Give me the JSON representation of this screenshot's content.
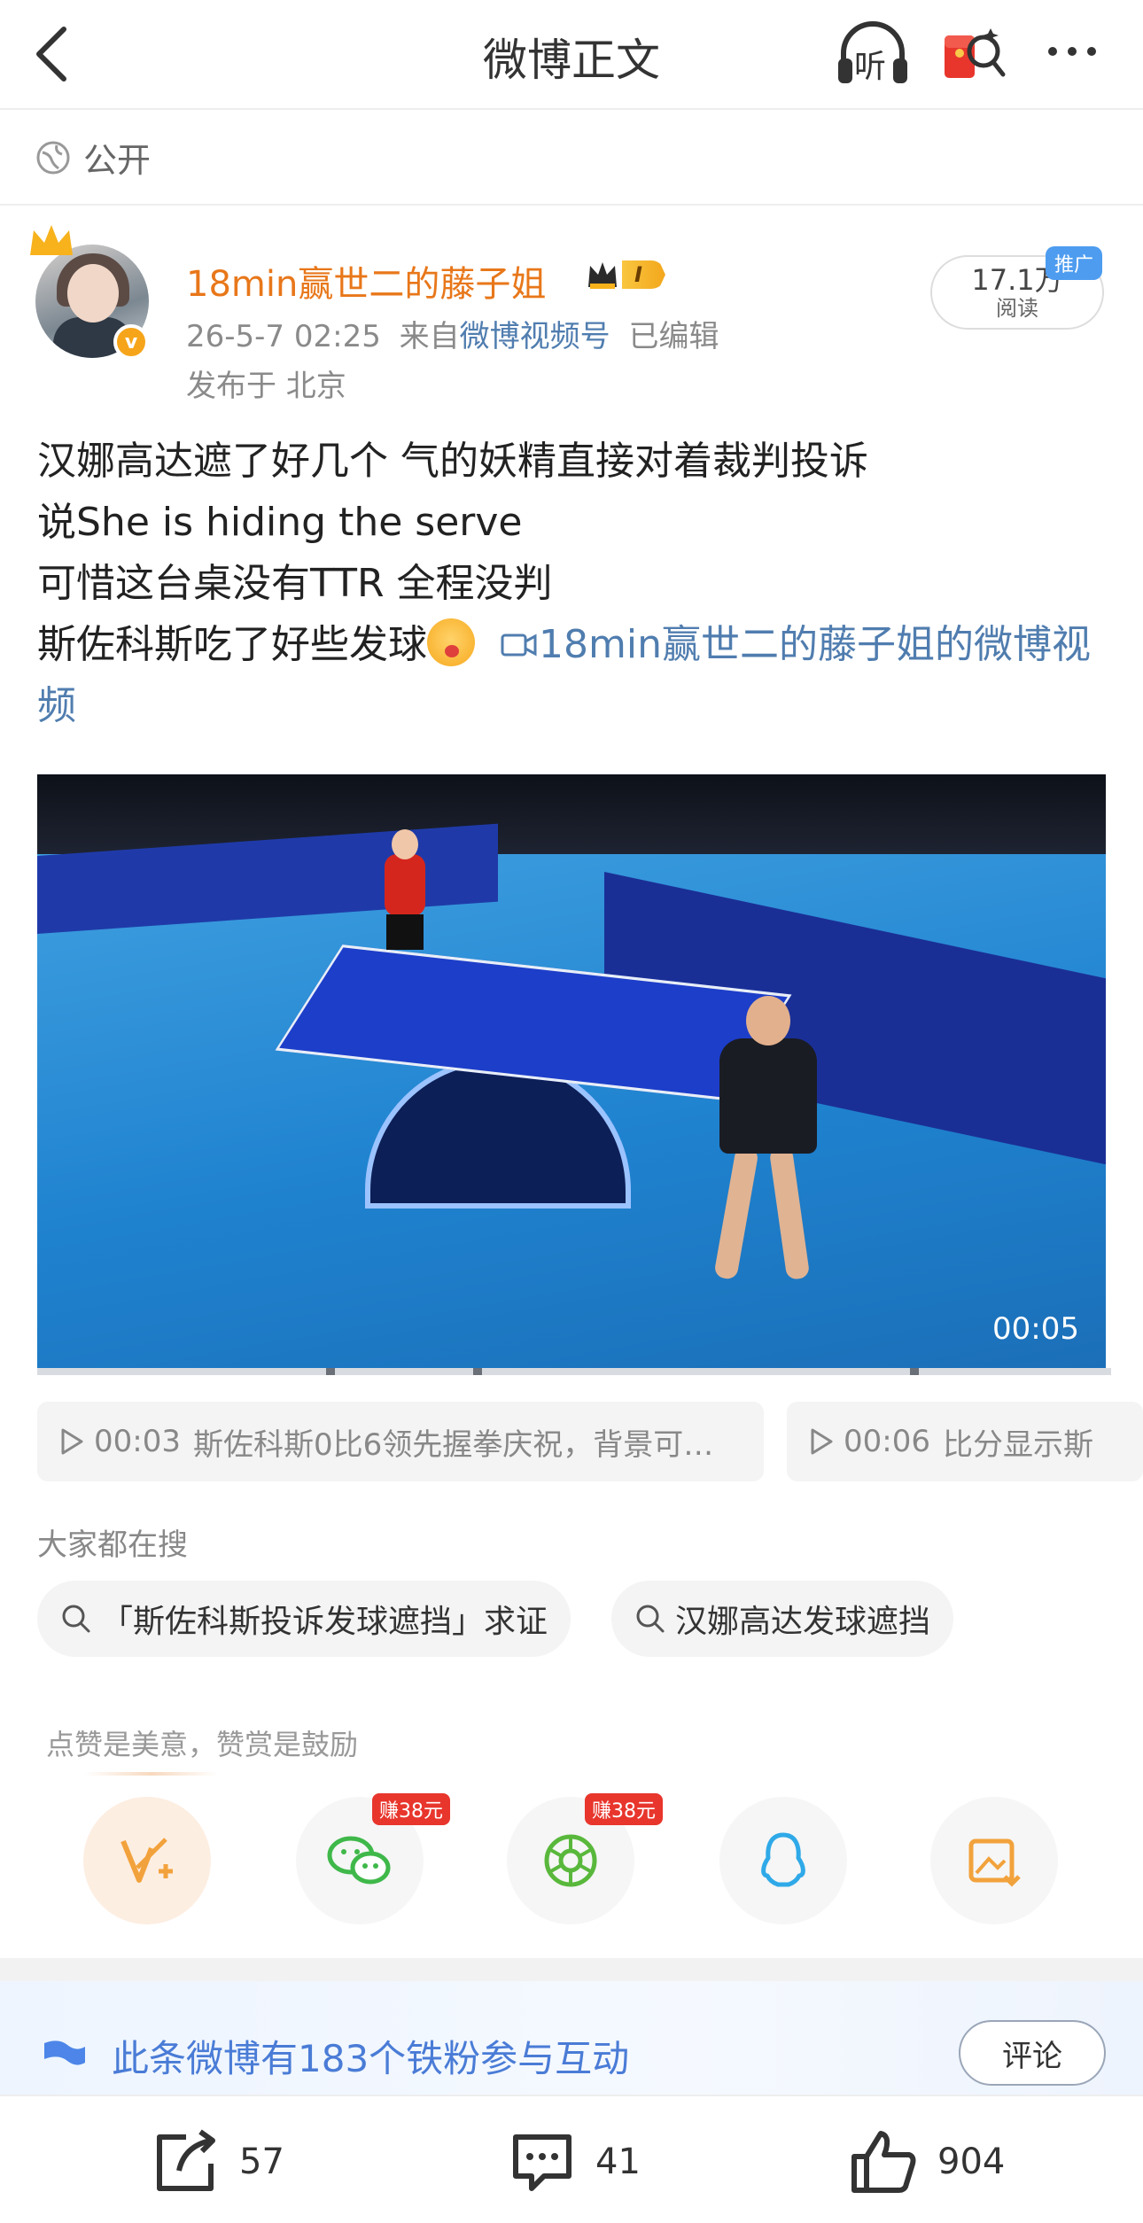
{
  "header": {
    "title": "微博正文",
    "listen_label": "听"
  },
  "visibility": {
    "label": "公开"
  },
  "post": {
    "author": "18min赢世二的藤子姐",
    "vip_label": "I",
    "verified_mark": "v",
    "time": "26-5-7 02:25",
    "from_prefix": "来自",
    "source": "微博视频号",
    "edited": "已编辑",
    "location": "发布于 北京",
    "reads": "17.1万",
    "reads_label": "阅读",
    "promo_badge": "推广",
    "lines": [
      "汉娜高达遮了好几个 气的妖精直接对着裁判投诉",
      "说She is hiding the serve",
      "可惜这台桌没有TTR 全程没判",
      "斯佐科斯吃了好些发球"
    ],
    "video_link": "18min赢世二的藤子姐的微博视频"
  },
  "video": {
    "duration": "00:05",
    "progress_segments": [
      0.27,
      0.13,
      0.4,
      0.18
    ]
  },
  "chapters": [
    {
      "time": "00:03",
      "text": "斯佐科斯0比6领先握拳庆祝，背景可…"
    },
    {
      "time": "00:06",
      "text": "比分显示斯"
    }
  ],
  "search": {
    "title": "大家都在搜",
    "items": [
      "「斯佐科斯投诉发球遮挡」求证",
      "汉娜高达发球遮挡"
    ]
  },
  "share": {
    "hint": "点赞是美意，赞赏是鼓励",
    "earn_badge": "赚38元",
    "icons": [
      "reward-icon",
      "wechat-icon",
      "moments-icon",
      "qq-icon",
      "save-image-icon"
    ]
  },
  "fans": {
    "text": "此条微博有183个铁粉参与互动",
    "button": "评论"
  },
  "actions": {
    "reposts": "57",
    "comments": "41",
    "likes": "904"
  },
  "colors": {
    "link": "#507daf",
    "username": "#e8771a",
    "badge_red": "#e8362d",
    "fan_blue": "#4a7cd6"
  }
}
